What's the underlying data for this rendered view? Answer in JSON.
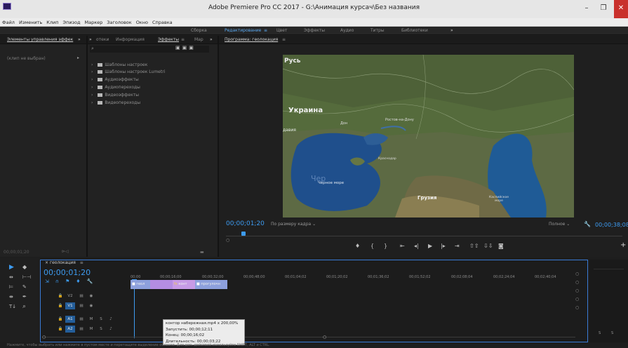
{
  "window": {
    "title": "Adobe Premiere Pro CC 2017 - G:\\Анимация курсач\\Без названия",
    "minimize": "–",
    "maximize": "❐",
    "close": "✕"
  },
  "menu": [
    "Файл",
    "Изменить",
    "Клип",
    "Эпизод",
    "Маркер",
    "Заголовок",
    "Окно",
    "Справка"
  ],
  "workspaces": {
    "items": [
      "Сборка",
      "Редактирование",
      "Цвет",
      "Эффекты",
      "Аудио",
      "Титры",
      "Библиотеки"
    ],
    "active": "Редактирование",
    "menu_glyph": "≡",
    "more": "»"
  },
  "effect_controls": {
    "tab": "Элементы управления эффек",
    "no_clip": "(клип не выбран)",
    "timecode": "00;00;01;20"
  },
  "effects_panel": {
    "tabs": [
      "отеки",
      "Информация",
      "Эффекты",
      "Мар"
    ],
    "active_tab": "Эффекты",
    "items": [
      "Шаблоны настроек",
      "Шаблоны настроек Lumetri",
      "Аудиоэффекты",
      "Аудиопереходы",
      "Видеоэффекты",
      "Видеопереходы"
    ]
  },
  "program_monitor": {
    "title": "Программа: геолокация",
    "menu_glyph": "≡",
    "timecode": "00;00;01;20",
    "fit_label": "По размеру кадра",
    "quality_label": "Полное",
    "duration": "00;00;38;08",
    "map_labels": {
      "top": "Русь",
      "ukraine": "Украина",
      "rostov": "Ростов-на-Дону",
      "don": "Дон",
      "krasnodar": "Краснодар",
      "moldova": "давия",
      "black_sea": "Черное море",
      "georgia": "Грузия",
      "caspian": "Каспийское море"
    }
  },
  "timeline": {
    "tab": "геолокация",
    "menu_glyph": "≡",
    "timecode": "00;00;01;20",
    "ruler": [
      "00;00",
      "00;00;16;00",
      "00;00;32;00",
      "00;00;48;00",
      "00;01;04;02",
      "00;01;20;02",
      "00;01;36;02",
      "00;01;52;02",
      "00;02;08;04",
      "00;02;24;04",
      "00;02;40;04"
    ],
    "tracks": [
      {
        "name": "V2",
        "on": false
      },
      {
        "name": "V1",
        "on": true
      },
      {
        "name": "A1",
        "on": true
      },
      {
        "name": "A2",
        "on": true
      }
    ],
    "clips": [
      "геол",
      "конт",
      "прогулочн"
    ],
    "audio_buttons": [
      "M",
      "S"
    ],
    "levels": [
      "S",
      "S"
    ]
  },
  "tooltip": {
    "line1": "контор набережная.mp4 x 200,00%",
    "line2": "Запустить: 00;00;12;11",
    "line3": "Конец: 00;00;16;02",
    "line4": "Длительность: 00;00;03;22"
  },
  "status_bar": "Нажмите, чтобы выбрать или нажмите в пустом месте и перетащите выделение области. Для доп. действий используйте SHIFT, ALT и CTRL."
}
